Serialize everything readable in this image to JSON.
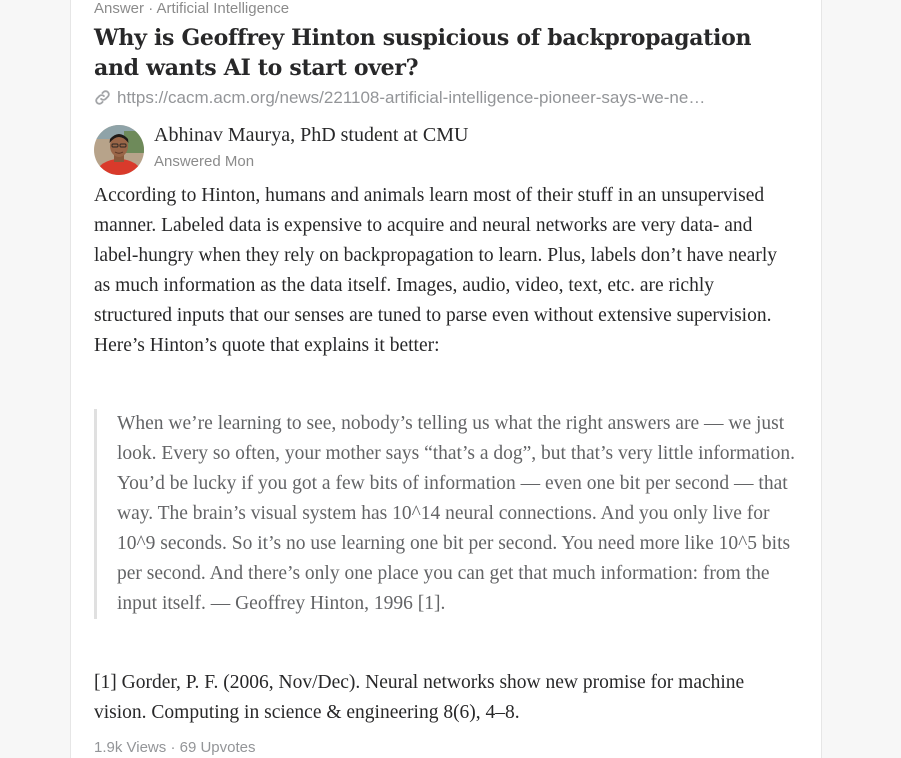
{
  "header": {
    "kind": "Answer",
    "separator": "·",
    "topic": "Artificial Intelligence"
  },
  "question": {
    "title": "Why is Geoffrey Hinton suspicious of backpropagation and wants AI to start over?",
    "link": "https://cacm.acm.org/news/221108-artificial-intelligence-pioneer-says-we-ne…",
    "link_icon": "link-icon"
  },
  "answer": {
    "author": "Abhinav Maurya, PhD student at CMU",
    "answered": "Answered Mon",
    "paragraph": "According to Hinton, humans and animals learn most of their stuff in an unsupervised manner. Labeled data is expensive to acquire and neural networks are very data- and label-hungry when they rely on backpropagation to learn. Plus, labels don’t have nearly as much information as the data itself. Images, audio, video, text, etc. are richly structured inputs that our senses are tuned to parse even without extensive supervision. Here’s Hinton’s quote that explains it better:",
    "quote": "When we’re learning to see, nobody’s telling us what the right answers are — we just look. Every so often, your mother says “that’s a dog”, but that’s very little information. You’d be lucky if you got a few bits of information — even one bit per second — that way. The brain’s visual system has 10^14 neural connections. And you only live for 10^9 seconds. So it’s no use learning one bit per second. You need more like 10^5 bits per second. And there’s only one place you can get that much information: from the input itself. — Geoffrey Hinton, 1996 [1].",
    "reference": "[1] Gorder, P. F. (2006, Nov/Dec). Neural networks show new promise for machine vision. Computing in science & engineering 8(6), 4–8."
  },
  "stats": {
    "views": "1.9k Views",
    "separator": "·",
    "upvotes": "69 Upvotes"
  },
  "colors": {
    "card_background": "#ffffff",
    "page_background": "#f7f7f7",
    "text": "#282829",
    "muted": "#8b8b8b",
    "quote_text": "#636466",
    "avatar_shirt": "#d93a2b"
  }
}
